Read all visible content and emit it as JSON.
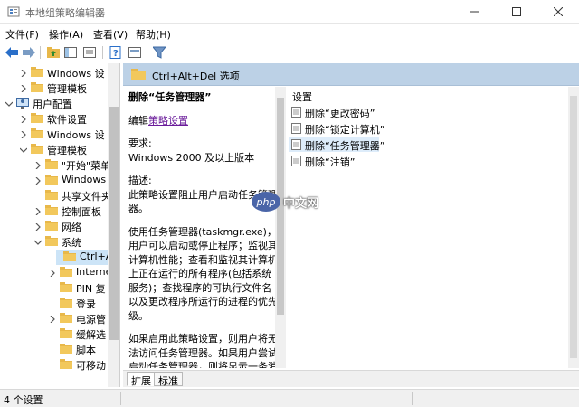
{
  "window": {
    "title": "本地组策略编辑器"
  },
  "menu": [
    {
      "label": "文件(F)"
    },
    {
      "label": "操作(A)"
    },
    {
      "label": "查看(V)"
    },
    {
      "label": "帮助(H)"
    }
  ],
  "tree": {
    "items": [
      {
        "label": "Windows 设",
        "indent": 1,
        "arrow": "right"
      },
      {
        "label": "管理模板",
        "indent": 1,
        "arrow": "right"
      },
      {
        "label": "用户配置",
        "indent": 0,
        "arrow": "down"
      },
      {
        "label": "软件设置",
        "indent": 1,
        "arrow": "right"
      },
      {
        "label": "Windows 设",
        "indent": 1,
        "arrow": "right"
      },
      {
        "label": "管理模板",
        "indent": 1,
        "arrow": "down"
      },
      {
        "label": "\"开始\"菜单",
        "indent": 2,
        "arrow": "right"
      },
      {
        "label": "Windows",
        "indent": 2,
        "arrow": "right"
      },
      {
        "label": "共享文件夹",
        "indent": 2,
        "arrow": "none"
      },
      {
        "label": "控制面板",
        "indent": 2,
        "arrow": "right"
      },
      {
        "label": "网络",
        "indent": 2,
        "arrow": "right"
      },
      {
        "label": "系统",
        "indent": 2,
        "arrow": "down"
      },
      {
        "label": "Ctrl+Alt",
        "indent": 3,
        "arrow": "none",
        "selected": true
      },
      {
        "label": "Interne",
        "indent": 3,
        "arrow": "right"
      },
      {
        "label": "PIN 复",
        "indent": 3,
        "arrow": "none"
      },
      {
        "label": "登录",
        "indent": 3,
        "arrow": "none"
      },
      {
        "label": "电源管",
        "indent": 3,
        "arrow": "right"
      },
      {
        "label": "缓解选",
        "indent": 3,
        "arrow": "none"
      },
      {
        "label": "脚本",
        "indent": 3,
        "arrow": "none"
      },
      {
        "label": "可移动",
        "indent": 3,
        "arrow": "none"
      }
    ]
  },
  "header": {
    "title": "Ctrl+Alt+Del 选项"
  },
  "description": {
    "title": "删除“任务管理器”",
    "edit_prefix": "编辑",
    "edit_link": "策略设置",
    "requirement_label": "要求:",
    "requirement_value": "Windows 2000 及以上版本",
    "desc_label": "描述:",
    "para1": "此策略设置阻止用户启动任务管理器。",
    "para2": "使用任务管理器(taskmgr.exe)，用户可以启动或停止程序；监视其计算机性能；查看和监视其计算机上正在运行的所有程序(包括系统服务)；查找程序的可执行文件名以及更改程序所运行的进程的优先级。",
    "para3": "如果启用此策略设置，则用户将无法访问任务管理器。如果用户尝试启动任务管理器，则将显示一条消息，说明某策略阻止该操作。"
  },
  "list": {
    "header": "设置",
    "items": [
      {
        "label": "删除“更改密码”"
      },
      {
        "label": "删除“锁定计算机”"
      },
      {
        "label": "删除“任务管理器”",
        "selected": true
      },
      {
        "label": "删除“注销”"
      }
    ]
  },
  "tabs": [
    {
      "label": "扩展",
      "active": true
    },
    {
      "label": "标准",
      "active": false
    }
  ],
  "status": {
    "text": "4 个设置"
  },
  "watermark": {
    "logo": "php",
    "text": "中文网"
  },
  "colors": {
    "header_bg": "#bcd1e6",
    "selection": "#cce4f7",
    "folder": "#e8b84a",
    "link": "#6a1b9a"
  }
}
